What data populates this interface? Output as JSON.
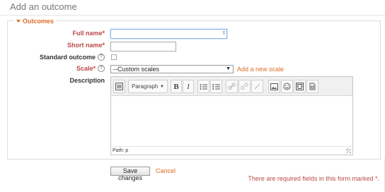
{
  "page": {
    "title": "Add an outcome"
  },
  "section": {
    "legend": "Outcomes"
  },
  "fields": {
    "full_name": {
      "label": "Full name",
      "value": "",
      "required": true
    },
    "short_name": {
      "label": "Short name",
      "value": "",
      "required": true
    },
    "standard_outcome": {
      "label": "Standard outcome",
      "checked": false
    },
    "scale": {
      "label": "Scale",
      "selected": "--Custom scales",
      "add_link": "Add a new scale",
      "required": true
    },
    "description": {
      "label": "Description"
    }
  },
  "editor": {
    "format_select": "Paragraph",
    "toolbar": [
      {
        "name": "toolbar-toggle",
        "icon": "toolbar-toggle-icon"
      },
      {
        "name": "bold",
        "glyph": "B"
      },
      {
        "name": "italic",
        "glyph": "I"
      },
      {
        "name": "bullet-list",
        "icon": "bullet-list-icon"
      },
      {
        "name": "numbered-list",
        "icon": "numbered-list-icon"
      },
      {
        "name": "link",
        "icon": "link-icon",
        "disabled": true
      },
      {
        "name": "unlink",
        "icon": "unlink-icon",
        "disabled": true
      },
      {
        "name": "special-char",
        "icon": "special-char-icon",
        "disabled": true
      },
      {
        "name": "image",
        "icon": "image-icon"
      },
      {
        "name": "emoticon",
        "icon": "emoticon-icon"
      },
      {
        "name": "media",
        "icon": "media-icon"
      },
      {
        "name": "manage-files",
        "icon": "manage-files-icon"
      }
    ],
    "path": "Path: p"
  },
  "actions": {
    "save": "Save changes",
    "cancel": "Cancel"
  },
  "required_note": {
    "text": "There are required fields in this form marked",
    "star": "*",
    "suffix": "."
  },
  "colors": {
    "accent": "#e06b28",
    "required": "#b94a48",
    "required_star": "#d43b3b"
  }
}
